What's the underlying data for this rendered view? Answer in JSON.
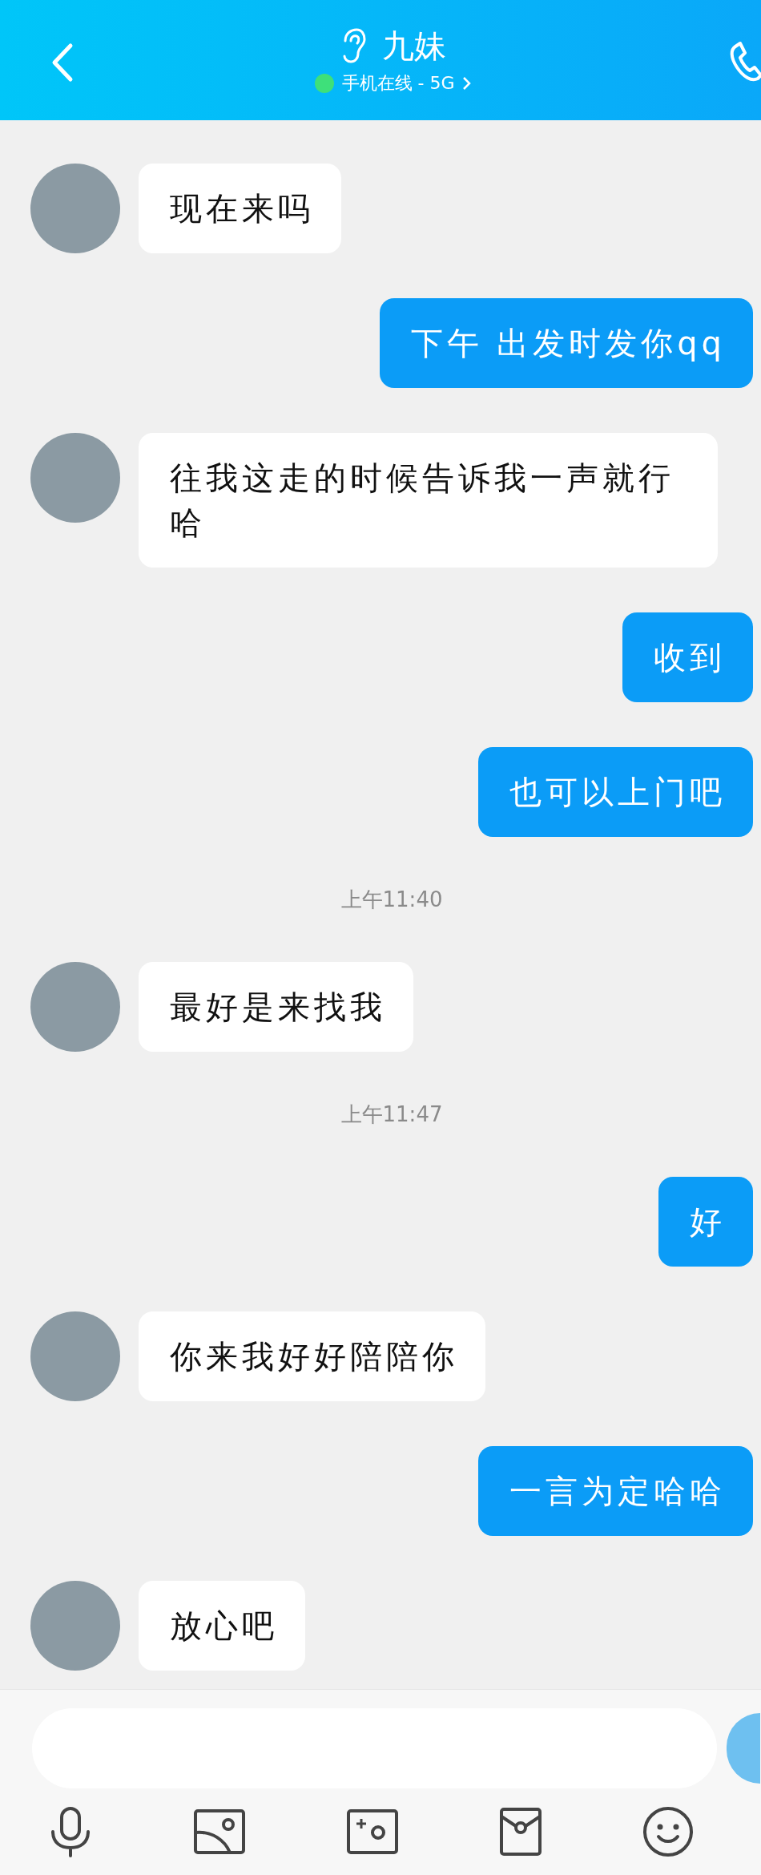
{
  "header": {
    "title": "九妹",
    "online": true,
    "status": "手机在线 - 5G"
  },
  "messages": [
    {
      "kind": "incoming",
      "text": "现在来吗"
    },
    {
      "kind": "outgoing",
      "text": "下午 出发时发你qq"
    },
    {
      "kind": "incoming",
      "text": "往我这走的时候告诉我一声就行哈"
    },
    {
      "kind": "outgoing",
      "text": "收到"
    },
    {
      "kind": "outgoing",
      "text": "也可以上门吧"
    },
    {
      "kind": "timestamp",
      "text": "上午11:40"
    },
    {
      "kind": "incoming",
      "text": "最好是来找我"
    },
    {
      "kind": "timestamp",
      "text": "上午11:47"
    },
    {
      "kind": "outgoing",
      "text": "好"
    },
    {
      "kind": "incoming",
      "text": "你来我好好陪陪你"
    },
    {
      "kind": "outgoing",
      "text": "一言为定哈哈"
    },
    {
      "kind": "incoming",
      "text": "放心吧"
    }
  ]
}
